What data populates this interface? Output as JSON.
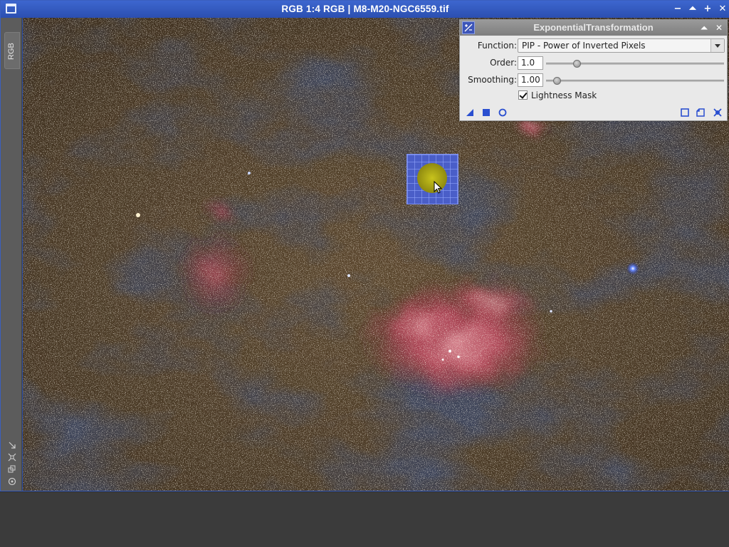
{
  "window": {
    "title": "RGB 1:4 RGB | M8-M20-NGC6559.tif",
    "side_tab": "RGB",
    "buttons": {
      "minimize": "−",
      "shade": "⏶",
      "maximize": "+",
      "close": "✕"
    }
  },
  "dialog": {
    "title": "ExponentialTransformation",
    "function_label": "Function:",
    "function_value": "PIP - Power of Inverted Pixels",
    "order_label": "Order:",
    "order_value": "1.0",
    "order_slider_fraction": 0.16,
    "smoothing_label": "Smoothing:",
    "smoothing_value": "1.00",
    "smoothing_slider_fraction": 0.04,
    "lightness_mask_label": "Lightness Mask",
    "lightness_mask_checked": true
  },
  "colors": {
    "window_title_bar": "#2f56b8",
    "dialog_title_bar": "#8a8a8a",
    "preview_box": "#4a5ec8",
    "preview_blob": "#b6b01a",
    "nebula": "#b84a5c"
  },
  "icons": {
    "dialog_footer_left": [
      "new-instance-icon",
      "apply-global-icon",
      "real-time-preview-icon"
    ],
    "dialog_footer_right": [
      "reset-icon",
      "browse-documentation-icon",
      "track-view-icon"
    ],
    "side_tools": [
      "expand-icon",
      "fit-view-icon",
      "zoom-icon",
      "options-icon"
    ]
  }
}
